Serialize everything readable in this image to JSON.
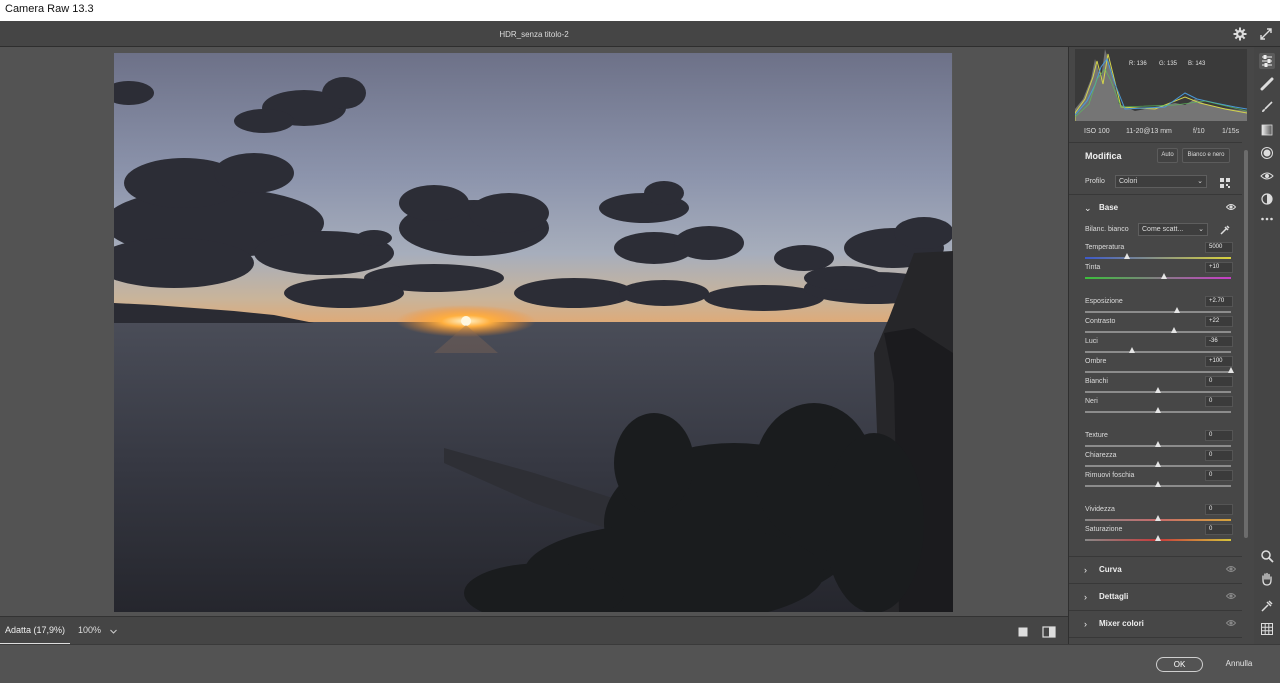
{
  "window_title": "Camera Raw 13.3",
  "document_title": "HDR_senza titolo-2",
  "histogram": {
    "r": "R: 136",
    "g": "G: 135",
    "b": "B: 143"
  },
  "exif": {
    "iso": "ISO 100",
    "lens": "11-20@13 mm",
    "aperture": "f/10",
    "shutter": "1/15s"
  },
  "edit_panel": {
    "title": "Modifica",
    "auto_label": "Auto",
    "bw_label": "Bianco e nero",
    "profile_label": "Profilo",
    "profile_value": "Colori"
  },
  "base": {
    "title": "Base",
    "wb_label": "Bilanc. bianco",
    "wb_value": "Come scatt...",
    "sliders": [
      {
        "name": "Temperatura",
        "value": "5000",
        "pos": 0.29
      },
      {
        "name": "Tinta",
        "value": "+10",
        "pos": 0.54
      },
      {
        "name": "Esposizione",
        "value": "+2.70",
        "pos": 0.63
      },
      {
        "name": "Contrasto",
        "value": "+22",
        "pos": 0.61
      },
      {
        "name": "Luci",
        "value": "-36",
        "pos": 0.32
      },
      {
        "name": "Ombre",
        "value": "+100",
        "pos": 1.0
      },
      {
        "name": "Bianchi",
        "value": "0",
        "pos": 0.5
      },
      {
        "name": "Neri",
        "value": "0",
        "pos": 0.5
      },
      {
        "name": "Texture",
        "value": "0",
        "pos": 0.5
      },
      {
        "name": "Chiarezza",
        "value": "0",
        "pos": 0.5
      },
      {
        "name": "Rimuovi foschia",
        "value": "0",
        "pos": 0.5
      },
      {
        "name": "Vividezza",
        "value": "0",
        "pos": 0.5
      },
      {
        "name": "Saturazione",
        "value": "0",
        "pos": 0.5
      }
    ]
  },
  "sections": [
    "Curva",
    "Dettagli",
    "Mixer colori"
  ],
  "zoom": {
    "fit": "Adatta (17,9%)",
    "level": "100%"
  },
  "buttons": {
    "ok": "OK",
    "cancel": "Annulla"
  },
  "tools": [
    "edit-sliders-icon",
    "healing-icon",
    "brush-icon",
    "linear-gradient-icon",
    "radial-gradient-icon",
    "red-eye-icon",
    "presets-icon",
    "more-icon",
    "zoom-icon",
    "hand-icon",
    "color-sampler-icon",
    "grid-icon"
  ],
  "colors": {
    "accent": "#dcdcdc",
    "panel": "#474747",
    "background": "#535353"
  }
}
